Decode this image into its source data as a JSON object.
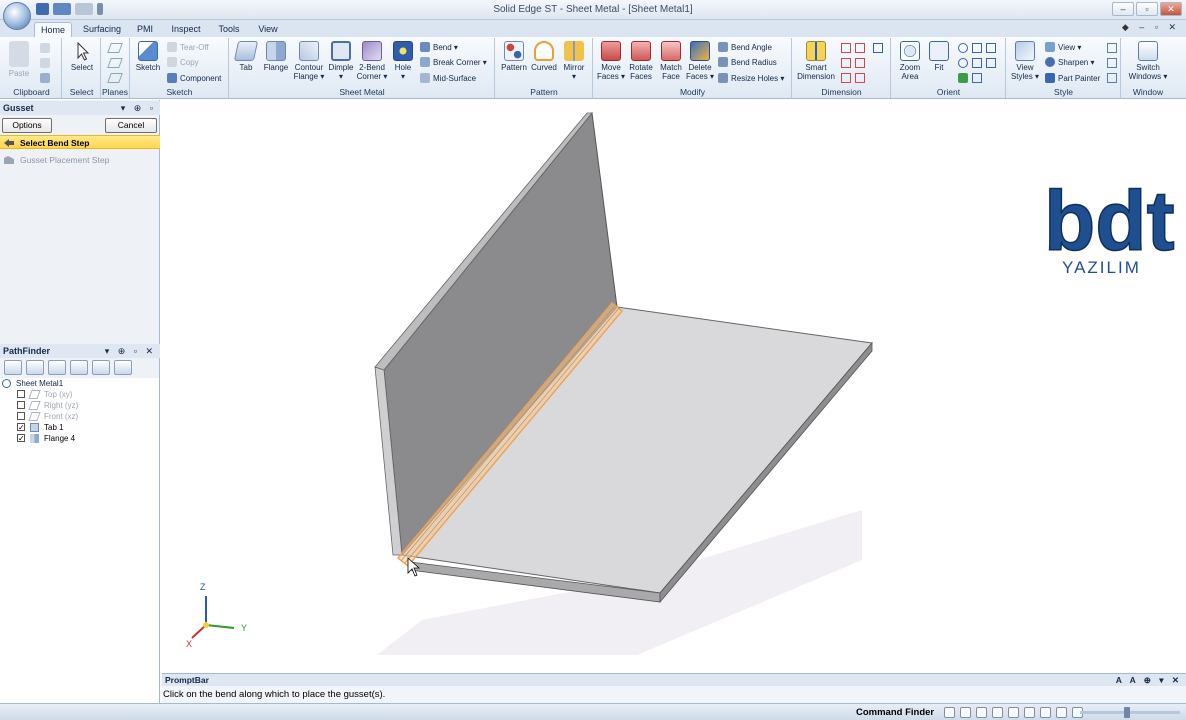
{
  "window": {
    "title": "Solid Edge ST - Sheet Metal - [Sheet Metal1]"
  },
  "tabs": [
    "Home",
    "Surfacing",
    "PMI",
    "Inspect",
    "Tools",
    "View"
  ],
  "ribbon": {
    "clipboard": {
      "label": "Clipboard",
      "paste": "Paste"
    },
    "select": {
      "label": "Select",
      "select": "Select"
    },
    "planes": {
      "label": "Planes"
    },
    "sketch": {
      "label": "Sketch",
      "sketch": "Sketch",
      "tear_off": "Tear-Off",
      "copy": "Copy",
      "component": "Component"
    },
    "sheet_metal": {
      "label": "Sheet Metal",
      "tab": "Tab",
      "flange": "Flange",
      "contour_flange_1": "Contour",
      "contour_flange_2": "Flange",
      "dimple": "Dimple",
      "two_bend_1": "2-Bend",
      "two_bend_2": "Corner",
      "hole": "Hole",
      "bend": "Bend",
      "break_corner": "Break Corner",
      "mid_surface": "Mid-Surface"
    },
    "pattern": {
      "label": "Pattern",
      "pattern": "Pattern",
      "curved": "Curved",
      "mirror": "Mirror"
    },
    "modify": {
      "label": "Modify",
      "move_faces_1": "Move",
      "move_faces_2": "Faces",
      "rotate_faces_1": "Rotate",
      "rotate_faces_2": "Faces",
      "match_face_1": "Match",
      "match_face_2": "Face",
      "delete_faces_1": "Delete",
      "delete_faces_2": "Faces",
      "bend_angle": "Bend Angle",
      "bend_radius": "Bend Radius",
      "resize_holes": "Resize Holes"
    },
    "dimension": {
      "label": "Dimension",
      "smart_1": "Smart",
      "smart_2": "Dimension"
    },
    "orient": {
      "label": "Orient",
      "zoom_area_1": "Zoom",
      "zoom_area_2": "Area",
      "fit": "Fit"
    },
    "style": {
      "label": "Style",
      "view_styles_1": "View",
      "view_styles_2": "Styles",
      "view": "View",
      "sharpen": "Sharpen",
      "part_painter": "Part Painter"
    },
    "window": {
      "label": "Window",
      "switch_1": "Switch",
      "switch_2": "Windows"
    }
  },
  "gusset_panel": {
    "title": "Gusset",
    "options_button": "Options",
    "cancel_button": "Cancel",
    "steps": [
      "Select Bend Step",
      "Gusset Placement Step"
    ]
  },
  "pathfinder": {
    "title": "PathFinder",
    "items": [
      {
        "label": "Sheet Metal1",
        "checked": null,
        "dim": false
      },
      {
        "label": "Top (xy)",
        "checked": false,
        "dim": true
      },
      {
        "label": "Right (yz)",
        "checked": false,
        "dim": true
      },
      {
        "label": "Front (xz)",
        "checked": false,
        "dim": true
      },
      {
        "label": "Tab 1",
        "checked": true,
        "dim": false
      },
      {
        "label": "Flange 4",
        "checked": true,
        "dim": false
      }
    ]
  },
  "viewport": {
    "axes": {
      "z": "Z",
      "y": "Y",
      "x": "X"
    },
    "logo": {
      "text": "bdt",
      "subtitle": "YAZILIM"
    }
  },
  "prompt_bar": {
    "title": "PromptBar",
    "text": "Click on the bend along which to place the gusset(s)."
  },
  "status_bar": {
    "command_finder": "Command Finder"
  },
  "colors": {
    "accent": "#ffd54a",
    "ribbon_bg": "#dfe8f3",
    "highlight_edge": "#f0a050",
    "logo_blue": "#1f4f8f"
  }
}
